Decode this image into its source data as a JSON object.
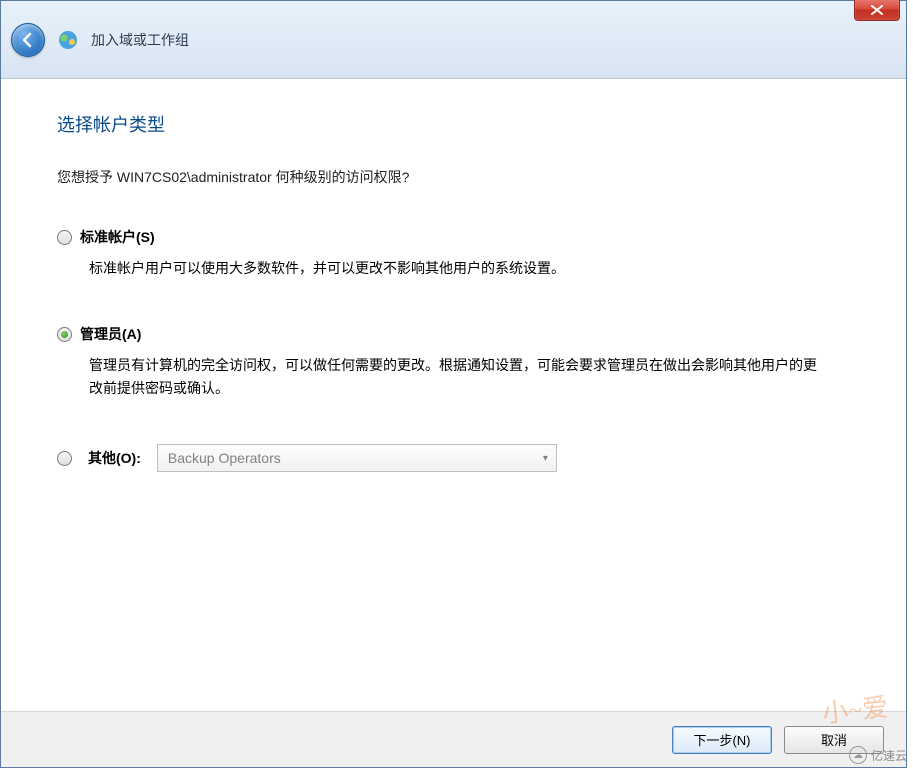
{
  "header": {
    "title": "加入域或工作组"
  },
  "page": {
    "heading": "选择帐户类型",
    "prompt": "您想授予 WIN7CS02\\administrator 何种级别的访问权限?"
  },
  "options": {
    "standard": {
      "label": "标准帐户(S)",
      "description": "标准帐户用户可以使用大多数软件，并可以更改不影响其他用户的系统设置。",
      "selected": false
    },
    "administrator": {
      "label": "管理员(A)",
      "description": "管理员有计算机的完全访问权，可以做任何需要的更改。根据通知设置，可能会要求管理员在做出会影响其他用户的更改前提供密码或确认。",
      "selected": true
    },
    "other": {
      "label": "其他(O):",
      "dropdown_value": "Backup Operators",
      "selected": false
    }
  },
  "buttons": {
    "next": "下一步(N)",
    "cancel": "取消"
  },
  "watermark": {
    "brand": "亿速云"
  }
}
